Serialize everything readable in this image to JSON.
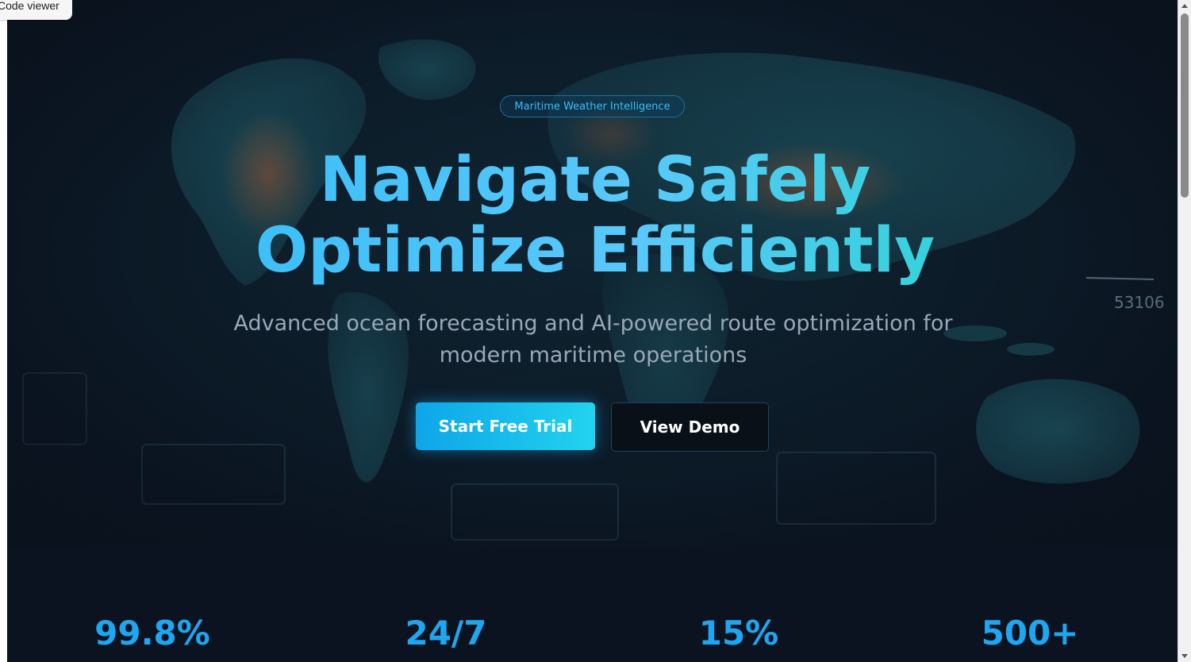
{
  "browser": {
    "tab_label": "Code viewer"
  },
  "hero": {
    "badge": "Maritime Weather Intelligence",
    "headline_line1": "Navigate Safely",
    "headline_line2": "Optimize Efficiently",
    "subtitle": "Advanced ocean forecasting and AI-powered route optimization for modern maritime operations",
    "primary_cta": "Start Free Trial",
    "secondary_cta": "View Demo",
    "background_map_label": "53106"
  },
  "stats": [
    {
      "value": "99.8%"
    },
    {
      "value": "24/7"
    },
    {
      "value": "15%"
    },
    {
      "value": "500+"
    }
  ],
  "colors": {
    "accent": "#38bdf8",
    "accent_secondary": "#22d3ee",
    "background": "#0b1220",
    "muted_text": "#9aa7b8"
  }
}
